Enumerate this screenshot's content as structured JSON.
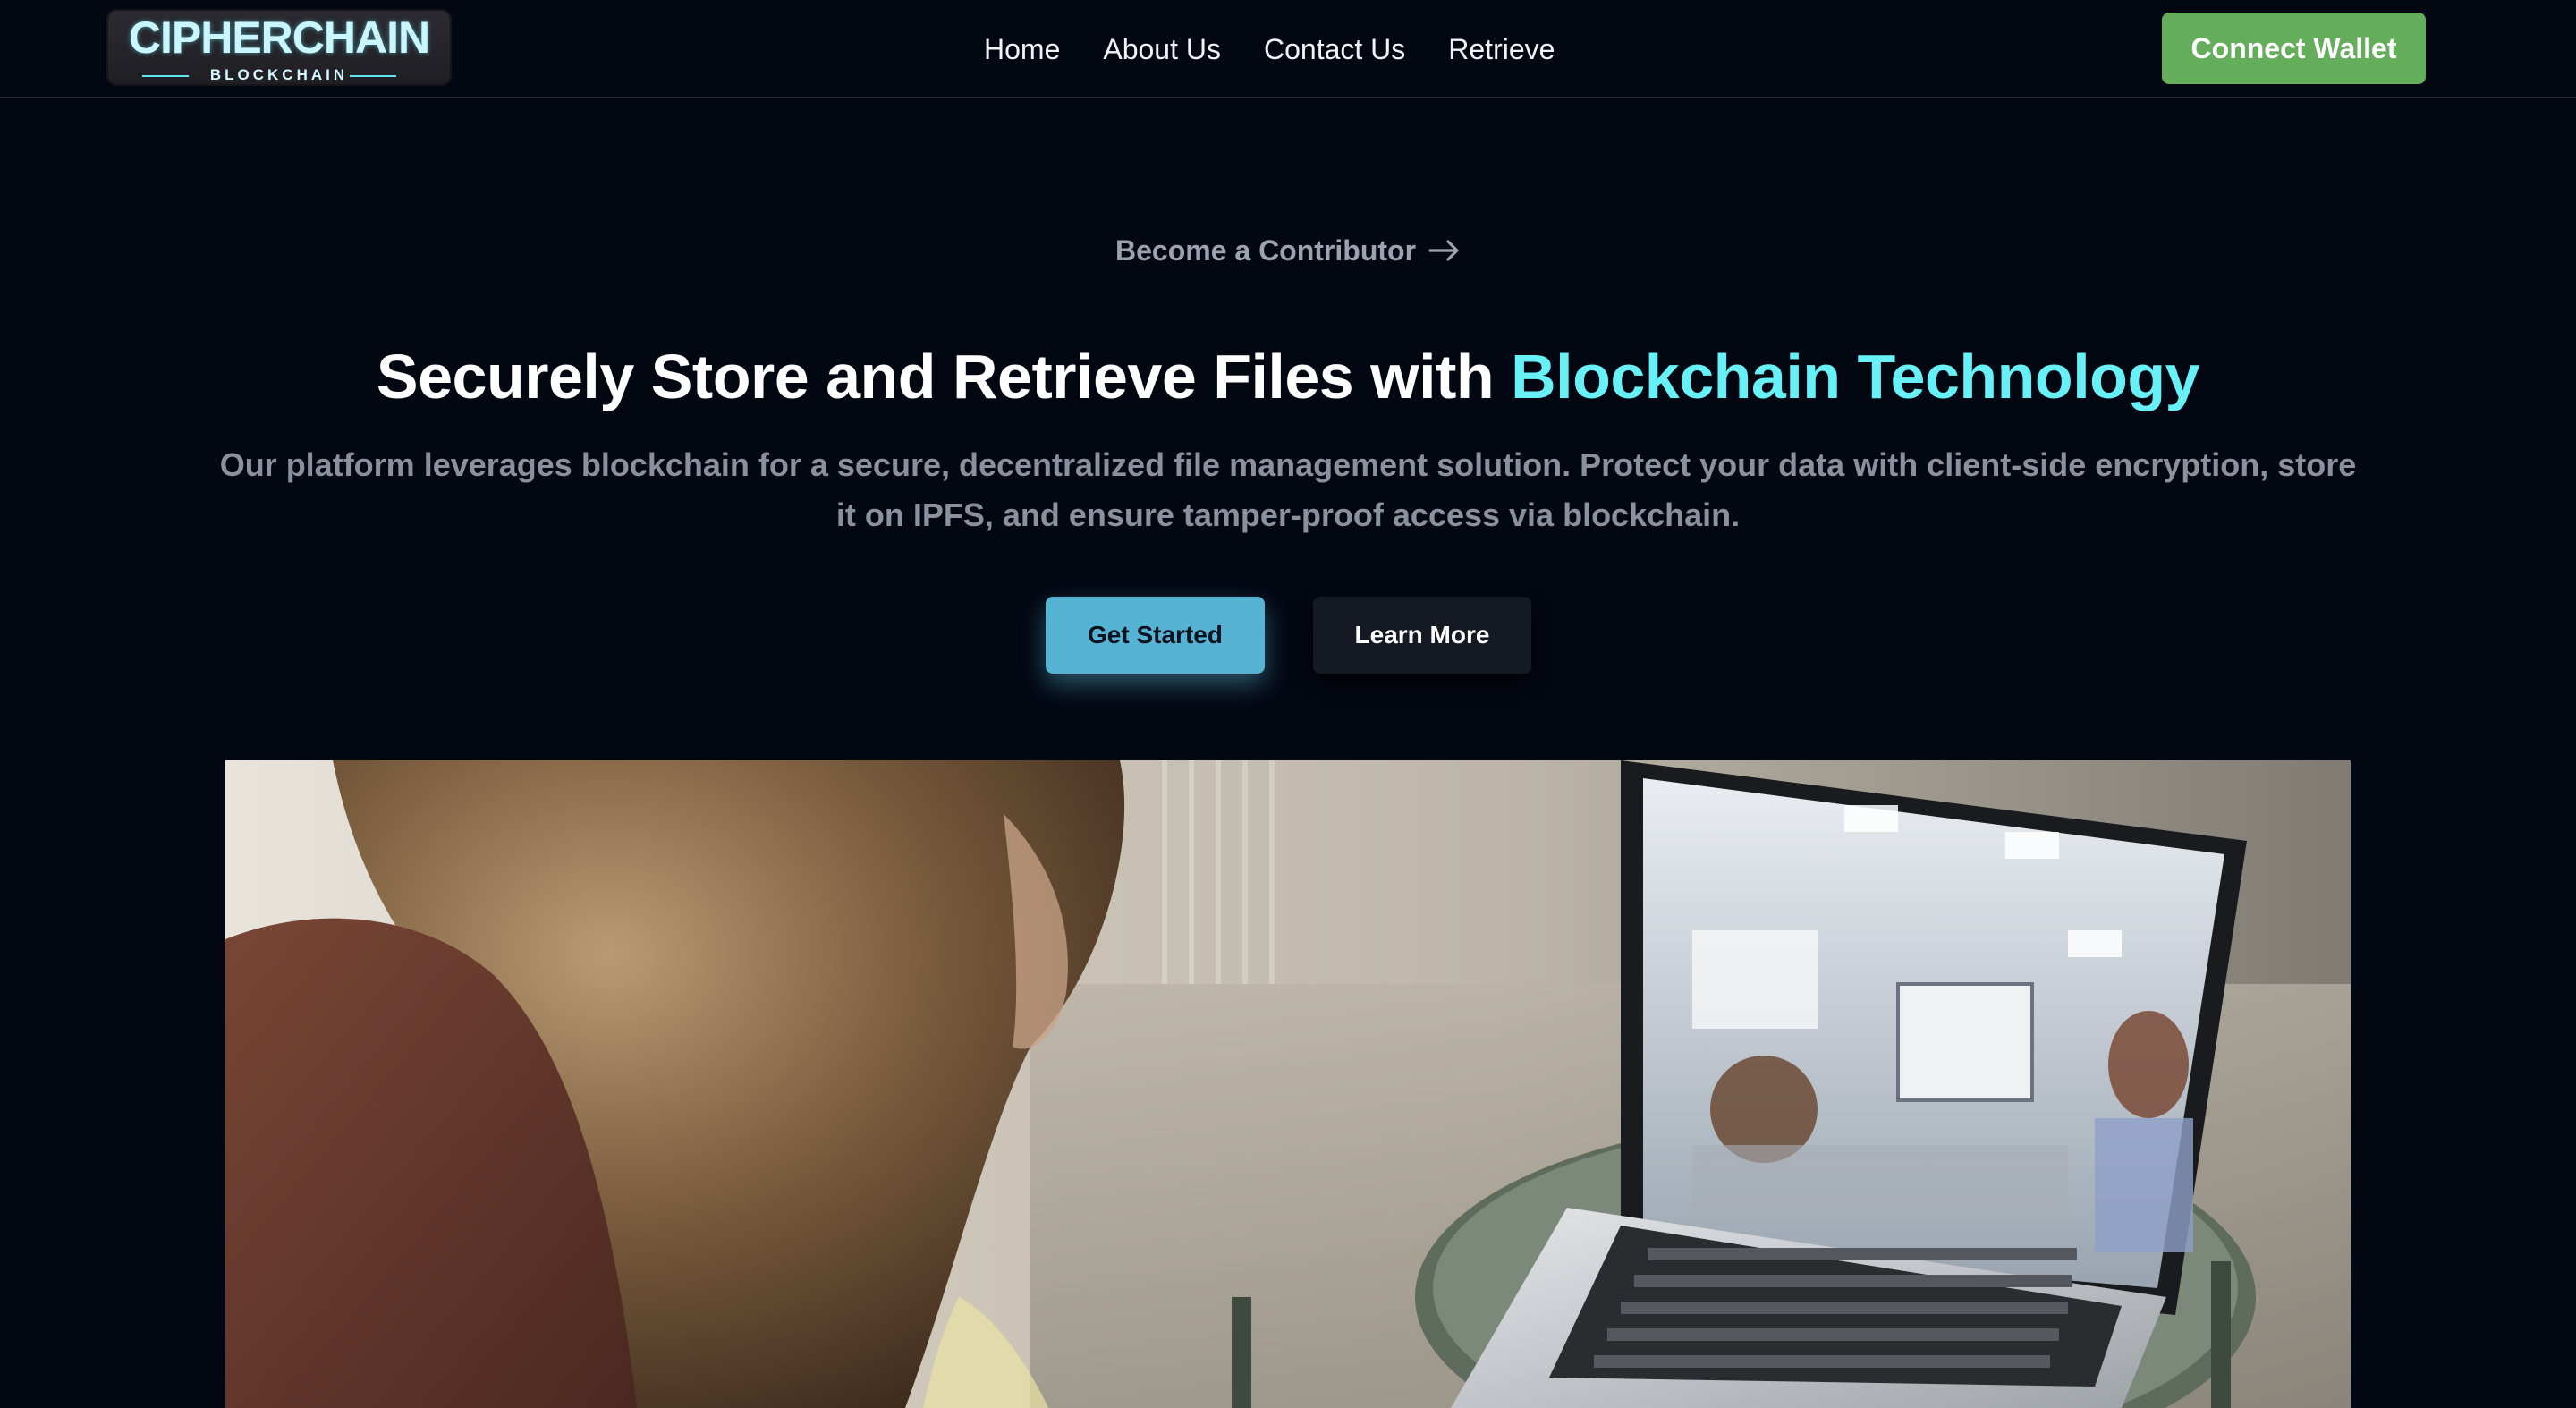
{
  "navbar": {
    "logo_title": "CIPHERCHAIN",
    "logo_subtitle": "BLOCKCHAIN",
    "links": [
      {
        "label": "Home"
      },
      {
        "label": "About Us"
      },
      {
        "label": "Contact Us"
      },
      {
        "label": "Retrieve"
      }
    ],
    "connect_label": "Connect Wallet"
  },
  "hero": {
    "contributor_label": "Become a Contributor",
    "contributor_icon": "arrow-right-icon",
    "headline_main": "Securely Store and Retrieve Files with ",
    "headline_accent": "Blockchain Technology",
    "description": "Our platform leverages blockchain for a secure, decentralized file management solution. Protect your data with client-side encryption, store it on IPFS, and ensure tamper-proof access via blockchain.",
    "primary_button": "Get Started",
    "secondary_button": "Learn More"
  },
  "media": {
    "icon": "hero-video-icon"
  },
  "colors": {
    "background": "#030712",
    "accent": "#67f0f5",
    "primary_button": "#57b3d3",
    "connect_button": "#64ad5b",
    "muted_text": "#8a919c"
  }
}
